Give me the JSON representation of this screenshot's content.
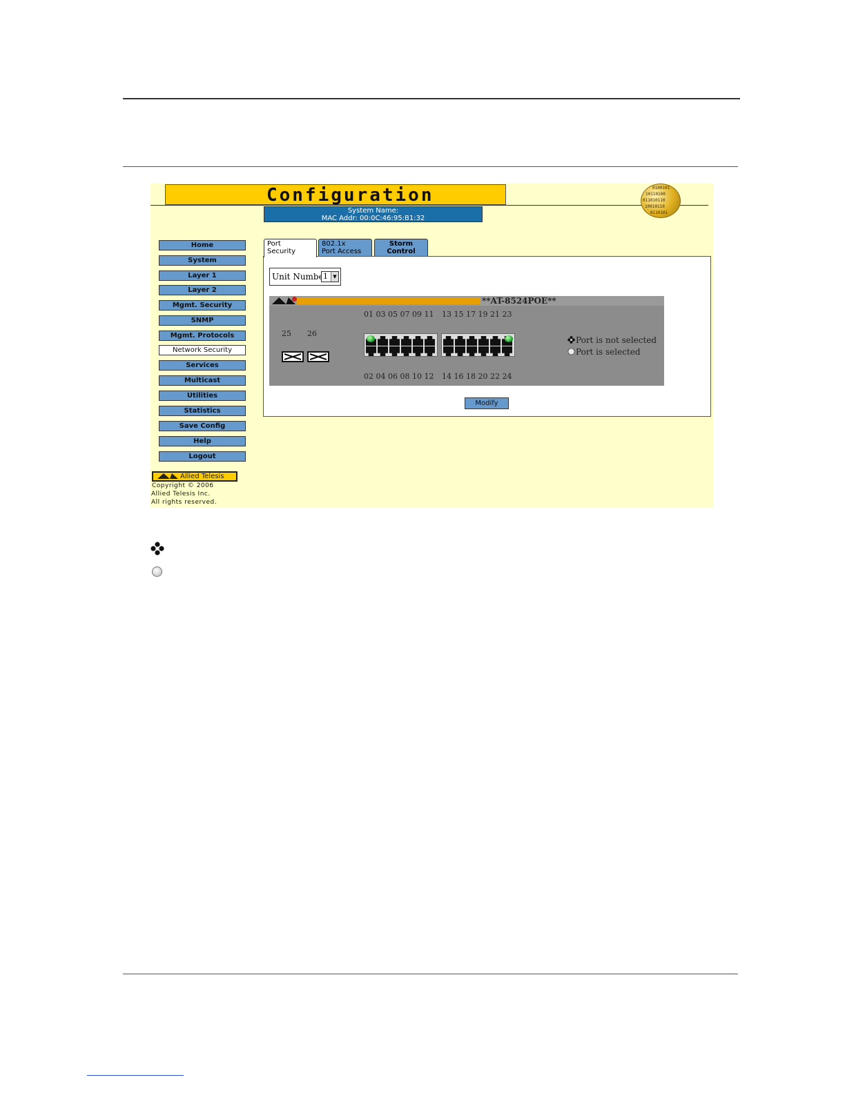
{
  "page": {
    "header_title": "Configuration",
    "system_name_label": "System Name:",
    "mac_label": "MAC Addr: 00:0C:46:95:B1:32",
    "globe_bits": [
      "0100101",
      "10110100",
      "011010110",
      "10010110",
      "0110101"
    ]
  },
  "sidebar": {
    "items": [
      {
        "label": "Home"
      },
      {
        "label": "System"
      },
      {
        "label": "Layer 1"
      },
      {
        "label": "Layer 2"
      },
      {
        "label": "Mgmt. Security"
      },
      {
        "label": "SNMP"
      },
      {
        "label": "Mgmt. Protocols"
      },
      {
        "label": "Network Security",
        "active": true
      },
      {
        "label": "Services"
      },
      {
        "label": "Multicast"
      },
      {
        "label": "Utilities"
      },
      {
        "label": "Statistics"
      },
      {
        "label": "Save Config"
      },
      {
        "label": "Help"
      },
      {
        "label": "Logout"
      }
    ],
    "logo_text": "Allied Telesis",
    "copyright": [
      "Copyright © 2006",
      "Allied Telesis  Inc.",
      "All rights reserved."
    ]
  },
  "tabs": [
    {
      "line1": "Port",
      "line2": "Security",
      "active": true
    },
    {
      "line1": "802.1x",
      "line2": "Port Access",
      "active": false
    },
    {
      "line1": "Storm",
      "line2": "Control",
      "active": false
    }
  ],
  "unit": {
    "label": "Unit Number",
    "value": "1"
  },
  "switch": {
    "model": "**AT-8524POE**",
    "sfp_ports": [
      "25",
      "26"
    ],
    "top_left_ports": "01 03 05 07 09 11",
    "top_right_ports": "13 15 17 19 21 23",
    "bottom_left_ports": "02 04 06 08 10 12",
    "bottom_right_ports": "14 16 18 20 22 24"
  },
  "legend": {
    "not_selected": "Port is not selected",
    "selected": "Port is selected"
  },
  "buttons": {
    "modify": "Modify"
  },
  "colors": {
    "title_bar": "#ffcc00",
    "nav_button": "#6699cc",
    "info_bar": "#1b6fa8",
    "background": "#ffffcc"
  }
}
